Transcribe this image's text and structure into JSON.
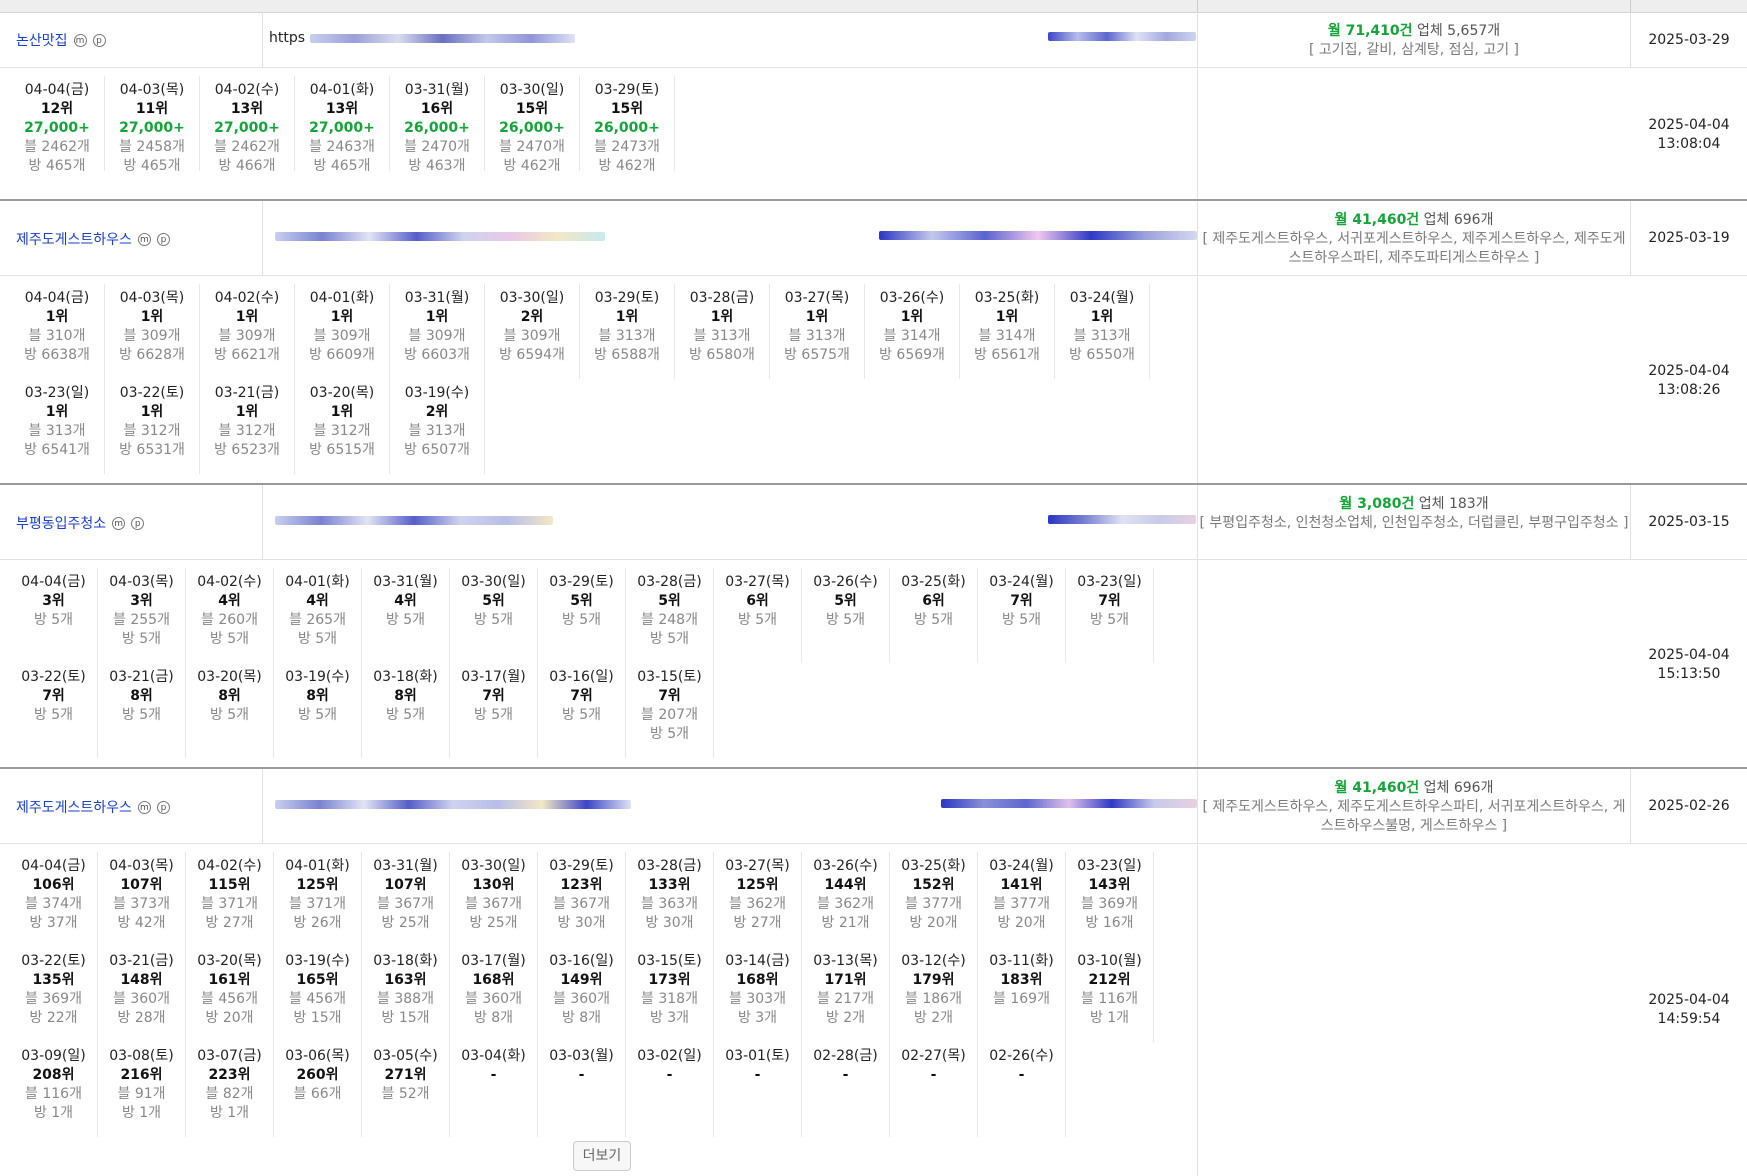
{
  "more_label": "더보기",
  "colors": {
    "link": "#1a3fc9",
    "monthly": "#15a43a",
    "muted": "#888888"
  },
  "entries": [
    {
      "name": "논산맛집",
      "url": "https",
      "monthly_label": "월 71,410건",
      "business_label": "업체 5,657개",
      "keywords": "[ 고기집, 갈비, 삼계탕, 점심, 고기 ]",
      "registered": "2025-03-29",
      "checked_date": "2025-04-04",
      "checked_time": "13:08:04",
      "days": [
        {
          "d": "04-04(금)",
          "r": "12위",
          "v": "27,000+",
          "b": "블 2462개",
          "p": "방 465개"
        },
        {
          "d": "04-03(목)",
          "r": "11위",
          "v": "27,000+",
          "b": "블 2458개",
          "p": "방 465개"
        },
        {
          "d": "04-02(수)",
          "r": "13위",
          "v": "27,000+",
          "b": "블 2462개",
          "p": "방 466개"
        },
        {
          "d": "04-01(화)",
          "r": "13위",
          "v": "27,000+",
          "b": "블 2463개",
          "p": "방 465개"
        },
        {
          "d": "03-31(월)",
          "r": "16위",
          "v": "26,000+",
          "b": "블 2470개",
          "p": "방 463개"
        },
        {
          "d": "03-30(일)",
          "r": "15위",
          "v": "26,000+",
          "b": "블 2470개",
          "p": "방 462개"
        },
        {
          "d": "03-29(토)",
          "r": "15위",
          "v": "26,000+",
          "b": "블 2473개",
          "p": "방 462개"
        }
      ]
    },
    {
      "name": "제주도게스트하우스",
      "url": "",
      "monthly_label": "월 41,460건",
      "business_label": "업체 696개",
      "keywords": "[ 제주도게스트하우스, 서귀포게스트하우스, 제주게스트하우스, 제주도게스트하우스파티, 제주도파티게스트하우스 ]",
      "registered": "2025-03-19",
      "checked_date": "2025-04-04",
      "checked_time": "13:08:26",
      "days": [
        {
          "d": "04-04(금)",
          "r": "1위",
          "b": "블 310개",
          "p": "방 6638개"
        },
        {
          "d": "04-03(목)",
          "r": "1위",
          "b": "블 309개",
          "p": "방 6628개"
        },
        {
          "d": "04-02(수)",
          "r": "1위",
          "b": "블 309개",
          "p": "방 6621개"
        },
        {
          "d": "04-01(화)",
          "r": "1위",
          "b": "블 309개",
          "p": "방 6609개"
        },
        {
          "d": "03-31(월)",
          "r": "1위",
          "b": "블 309개",
          "p": "방 6603개"
        },
        {
          "d": "03-30(일)",
          "r": "2위",
          "b": "블 309개",
          "p": "방 6594개"
        },
        {
          "d": "03-29(토)",
          "r": "1위",
          "b": "블 313개",
          "p": "방 6588개"
        },
        {
          "d": "03-28(금)",
          "r": "1위",
          "b": "블 313개",
          "p": "방 6580개"
        },
        {
          "d": "03-27(목)",
          "r": "1위",
          "b": "블 313개",
          "p": "방 6575개"
        },
        {
          "d": "03-26(수)",
          "r": "1위",
          "b": "블 314개",
          "p": "방 6569개"
        },
        {
          "d": "03-25(화)",
          "r": "1위",
          "b": "블 314개",
          "p": "방 6561개"
        },
        {
          "d": "03-24(월)",
          "r": "1위",
          "b": "블 313개",
          "p": "방 6550개"
        },
        {
          "d": "03-23(일)",
          "r": "1위",
          "b": "블 313개",
          "p": "방 6541개"
        },
        {
          "d": "03-22(토)",
          "r": "1위",
          "b": "블 312개",
          "p": "방 6531개"
        },
        {
          "d": "03-21(금)",
          "r": "1위",
          "b": "블 312개",
          "p": "방 6523개"
        },
        {
          "d": "03-20(목)",
          "r": "1위",
          "b": "블 312개",
          "p": "방 6515개"
        },
        {
          "d": "03-19(수)",
          "r": "2위",
          "b": "블 313개",
          "p": "방 6507개"
        }
      ]
    },
    {
      "name": "부평동입주청소",
      "url": "",
      "monthly_label": "월 3,080건",
      "business_label": "업체 183개",
      "keywords": "[ 부평입주청소, 인천청소업체, 인천입주청소, 더럽클린, 부평구입주청소 ]",
      "registered": "2025-03-15",
      "checked_date": "2025-04-04",
      "checked_time": "15:13:50",
      "days": [
        {
          "d": "04-04(금)",
          "r": "3위",
          "p": "방 5개"
        },
        {
          "d": "04-03(목)",
          "r": "3위",
          "b": "블 255개",
          "p": "방 5개"
        },
        {
          "d": "04-02(수)",
          "r": "4위",
          "b": "블 260개",
          "p": "방 5개"
        },
        {
          "d": "04-01(화)",
          "r": "4위",
          "b": "블 265개",
          "p": "방 5개"
        },
        {
          "d": "03-31(월)",
          "r": "4위",
          "p": "방 5개"
        },
        {
          "d": "03-30(일)",
          "r": "5위",
          "p": "방 5개"
        },
        {
          "d": "03-29(토)",
          "r": "5위",
          "p": "방 5개"
        },
        {
          "d": "03-28(금)",
          "r": "5위",
          "b": "블 248개",
          "p": "방 5개"
        },
        {
          "d": "03-27(목)",
          "r": "6위",
          "p": "방 5개"
        },
        {
          "d": "03-26(수)",
          "r": "5위",
          "p": "방 5개"
        },
        {
          "d": "03-25(화)",
          "r": "6위",
          "p": "방 5개"
        },
        {
          "d": "03-24(월)",
          "r": "7위",
          "p": "방 5개"
        },
        {
          "d": "03-23(일)",
          "r": "7위",
          "p": "방 5개"
        },
        {
          "d": "03-22(토)",
          "r": "7위",
          "p": "방 5개"
        },
        {
          "d": "03-21(금)",
          "r": "8위",
          "p": "방 5개"
        },
        {
          "d": "03-20(목)",
          "r": "8위",
          "p": "방 5개"
        },
        {
          "d": "03-19(수)",
          "r": "8위",
          "p": "방 5개"
        },
        {
          "d": "03-18(화)",
          "r": "8위",
          "p": "방 5개"
        },
        {
          "d": "03-17(월)",
          "r": "7위",
          "p": "방 5개"
        },
        {
          "d": "03-16(일)",
          "r": "7위",
          "p": "방 5개"
        },
        {
          "d": "03-15(토)",
          "r": "7위",
          "b": "블 207개",
          "p": "방 5개"
        }
      ]
    },
    {
      "name": "제주도게스트하우스",
      "url": "",
      "monthly_label": "월 41,460건",
      "business_label": "업체 696개",
      "keywords": "[ 제주도게스트하우스, 제주도게스트하우스파티, 서귀포게스트하우스, 게스트하우스불멍, 게스트하우스 ]",
      "registered": "2025-02-26",
      "checked_date": "2025-04-04",
      "checked_time": "14:59:54",
      "days": [
        {
          "d": "04-04(금)",
          "r": "106위",
          "b": "블 374개",
          "p": "방 37개"
        },
        {
          "d": "04-03(목)",
          "r": "107위",
          "b": "블 373개",
          "p": "방 42개"
        },
        {
          "d": "04-02(수)",
          "r": "115위",
          "b": "블 371개",
          "p": "방 27개"
        },
        {
          "d": "04-01(화)",
          "r": "125위",
          "b": "블 371개",
          "p": "방 26개"
        },
        {
          "d": "03-31(월)",
          "r": "107위",
          "b": "블 367개",
          "p": "방 25개"
        },
        {
          "d": "03-30(일)",
          "r": "130위",
          "b": "블 367개",
          "p": "방 25개"
        },
        {
          "d": "03-29(토)",
          "r": "123위",
          "b": "블 367개",
          "p": "방 30개"
        },
        {
          "d": "03-28(금)",
          "r": "133위",
          "b": "블 363개",
          "p": "방 30개"
        },
        {
          "d": "03-27(목)",
          "r": "125위",
          "b": "블 362개",
          "p": "방 27개"
        },
        {
          "d": "03-26(수)",
          "r": "144위",
          "b": "블 362개",
          "p": "방 21개"
        },
        {
          "d": "03-25(화)",
          "r": "152위",
          "b": "블 377개",
          "p": "방 20개"
        },
        {
          "d": "03-24(월)",
          "r": "141위",
          "b": "블 377개",
          "p": "방 20개"
        },
        {
          "d": "03-23(일)",
          "r": "143위",
          "b": "블 369개",
          "p": "방 16개"
        },
        {
          "d": "03-22(토)",
          "r": "135위",
          "b": "블 369개",
          "p": "방 22개"
        },
        {
          "d": "03-21(금)",
          "r": "148위",
          "b": "블 360개",
          "p": "방 28개"
        },
        {
          "d": "03-20(목)",
          "r": "161위",
          "b": "블 456개",
          "p": "방 20개"
        },
        {
          "d": "03-19(수)",
          "r": "165위",
          "b": "블 456개",
          "p": "방 15개"
        },
        {
          "d": "03-18(화)",
          "r": "163위",
          "b": "블 388개",
          "p": "방 15개"
        },
        {
          "d": "03-17(월)",
          "r": "168위",
          "b": "블 360개",
          "p": "방 8개"
        },
        {
          "d": "03-16(일)",
          "r": "149위",
          "b": "블 360개",
          "p": "방 8개"
        },
        {
          "d": "03-15(토)",
          "r": "173위",
          "b": "블 318개",
          "p": "방 3개"
        },
        {
          "d": "03-14(금)",
          "r": "168위",
          "b": "블 303개",
          "p": "방 3개"
        },
        {
          "d": "03-13(목)",
          "r": "171위",
          "b": "블 217개",
          "p": "방 2개"
        },
        {
          "d": "03-12(수)",
          "r": "179위",
          "b": "블 186개",
          "p": "방 2개"
        },
        {
          "d": "03-11(화)",
          "r": "183위",
          "b": "블 169개"
        },
        {
          "d": "03-10(월)",
          "r": "212위",
          "b": "블 116개",
          "p": "방 1개"
        },
        {
          "d": "03-09(일)",
          "r": "208위",
          "b": "블 116개",
          "p": "방 1개"
        },
        {
          "d": "03-08(토)",
          "r": "216위",
          "b": "블 91개",
          "p": "방 1개"
        },
        {
          "d": "03-07(금)",
          "r": "223위",
          "b": "블 82개",
          "p": "방 1개"
        },
        {
          "d": "03-06(목)",
          "r": "260위",
          "b": "블 66개"
        },
        {
          "d": "03-05(수)",
          "r": "271위",
          "b": "블 52개"
        },
        {
          "d": "03-04(화)",
          "r": "-"
        },
        {
          "d": "03-03(월)",
          "r": "-"
        },
        {
          "d": "03-02(일)",
          "r": "-"
        },
        {
          "d": "03-01(토)",
          "r": "-"
        },
        {
          "d": "02-28(금)",
          "r": "-"
        },
        {
          "d": "02-27(목)",
          "r": "-"
        },
        {
          "d": "02-26(수)",
          "r": "-"
        }
      ]
    }
  ]
}
